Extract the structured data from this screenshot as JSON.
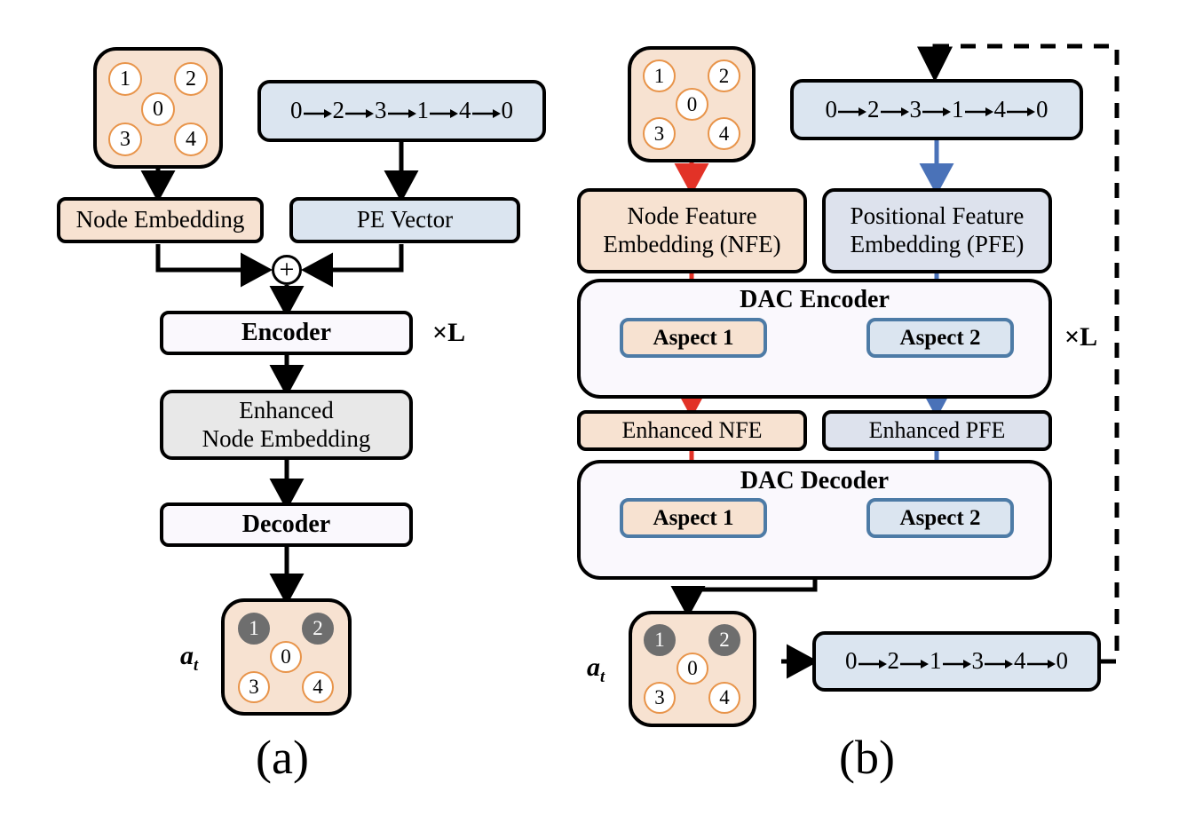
{
  "figure": {
    "panel_a_label": "(a)",
    "panel_b_label": "(b)",
    "repeat_label_a": "×L",
    "repeat_label_b": "×L",
    "colors": {
      "peach_fill": "#f7e2d1",
      "blue_fill": "#dbe5f0",
      "blue_fill_alt": "#dde2ed",
      "lavender_fill": "#faf8fd",
      "gray_fill": "#e8e8e8",
      "node_ring": "#e8944a",
      "node_selected": "#6e6e6e",
      "aspect_border": "#4d7ba6",
      "red_flow": "#e23227",
      "blue_flow": "#4a72b8",
      "black_flow": "#000000"
    }
  },
  "panel_a": {
    "graph_input": {
      "name": "node-graph",
      "nodes": [
        {
          "id": "1",
          "selected": false
        },
        {
          "id": "2",
          "selected": false
        },
        {
          "id": "0",
          "selected": false
        },
        {
          "id": "3",
          "selected": false
        },
        {
          "id": "4",
          "selected": false
        }
      ]
    },
    "sequence_input": {
      "tokens": [
        "0",
        "2",
        "3",
        "1",
        "4",
        "0"
      ],
      "separator": "→"
    },
    "node_embedding_label": "Node Embedding",
    "pe_vector_label": "PE Vector",
    "add_symbol": "+",
    "encoder_label": "Encoder",
    "repeat_label": "×L",
    "enhanced_node_embedding_label_line1": "Enhanced",
    "enhanced_node_embedding_label_line2": "Node Embedding",
    "decoder_label": "Decoder",
    "action_label": "a",
    "action_subscript": "t",
    "graph_output": {
      "nodes": [
        {
          "id": "1",
          "selected": true
        },
        {
          "id": "2",
          "selected": true
        },
        {
          "id": "0",
          "selected": false
        },
        {
          "id": "3",
          "selected": false
        },
        {
          "id": "4",
          "selected": false
        }
      ]
    },
    "caption": "(a)"
  },
  "panel_b": {
    "graph_input": {
      "nodes": [
        {
          "id": "1",
          "selected": false
        },
        {
          "id": "2",
          "selected": false
        },
        {
          "id": "0",
          "selected": false
        },
        {
          "id": "3",
          "selected": false
        },
        {
          "id": "4",
          "selected": false
        }
      ]
    },
    "sequence_input": {
      "tokens": [
        "0",
        "2",
        "3",
        "1",
        "4",
        "0"
      ],
      "separator": "→"
    },
    "nfe_label_line1": "Node Feature",
    "nfe_label_line2": "Embedding (NFE)",
    "pfe_label_line1": "Positional Feature",
    "pfe_label_line2": "Embedding (PFE)",
    "dac_encoder_title": "DAC Encoder",
    "encoder_aspect1_label": "Aspect 1",
    "encoder_aspect2_label": "Aspect 2",
    "repeat_label": "×L",
    "enhanced_nfe_label": "Enhanced NFE",
    "enhanced_pfe_label": "Enhanced PFE",
    "dac_decoder_title": "DAC Decoder",
    "decoder_aspect1_label": "Aspect 1",
    "decoder_aspect2_label": "Aspect 2",
    "action_label": "a",
    "action_subscript": "t",
    "graph_output": {
      "nodes": [
        {
          "id": "1",
          "selected": true
        },
        {
          "id": "2",
          "selected": true
        },
        {
          "id": "0",
          "selected": false
        },
        {
          "id": "3",
          "selected": false
        },
        {
          "id": "4",
          "selected": false
        }
      ]
    },
    "sequence_output": {
      "tokens": [
        "0",
        "2",
        "1",
        "3",
        "4",
        "0"
      ],
      "separator": "→"
    },
    "caption": "(b)"
  }
}
